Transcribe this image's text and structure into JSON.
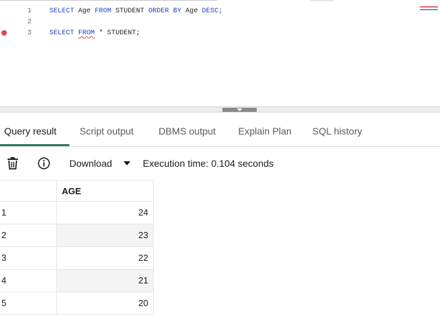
{
  "editor": {
    "lines": [
      {
        "number": "1",
        "tokens": [
          {
            "text": "SELECT",
            "kind": "kw"
          },
          {
            "text": " ",
            "kind": "id"
          },
          {
            "text": "Age",
            "kind": "id"
          },
          {
            "text": " ",
            "kind": "id"
          },
          {
            "text": "FROM",
            "kind": "kw"
          },
          {
            "text": " ",
            "kind": "id"
          },
          {
            "text": "STUDENT",
            "kind": "id"
          },
          {
            "text": " ",
            "kind": "id"
          },
          {
            "text": "ORDER",
            "kind": "kw"
          },
          {
            "text": " ",
            "kind": "id"
          },
          {
            "text": "BY",
            "kind": "kw"
          },
          {
            "text": " ",
            "kind": "id"
          },
          {
            "text": "Age",
            "kind": "id"
          },
          {
            "text": " ",
            "kind": "id"
          },
          {
            "text": "DESC;",
            "kind": "kw"
          }
        ]
      },
      {
        "number": "2",
        "tokens": []
      },
      {
        "number": "3",
        "breakpoint": true,
        "tokens": [
          {
            "text": "SELECT",
            "kind": "kw"
          },
          {
            "text": " ",
            "kind": "id"
          },
          {
            "text": "FROM",
            "kind": "kw",
            "error": true
          },
          {
            "text": " ",
            "kind": "id"
          },
          {
            "text": "*",
            "kind": "id"
          },
          {
            "text": " ",
            "kind": "id"
          },
          {
            "text": "STUDENT;",
            "kind": "id"
          }
        ]
      }
    ]
  },
  "tabs": [
    {
      "label": "Query result",
      "active": true
    },
    {
      "label": "Script output",
      "active": false
    },
    {
      "label": "DBMS output",
      "active": false
    },
    {
      "label": "Explain Plan",
      "active": false
    },
    {
      "label": "SQL history",
      "active": false
    }
  ],
  "toolbar": {
    "delete_icon": "trash-icon",
    "info_icon": "info-icon",
    "download_label": "Download",
    "execution_time": "Execution time: 0.104 seconds"
  },
  "results": {
    "columns": [
      "AGE"
    ],
    "rows": [
      {
        "row_number": "1",
        "age": "24"
      },
      {
        "row_number": "2",
        "age": "23"
      },
      {
        "row_number": "3",
        "age": "22"
      },
      {
        "row_number": "4",
        "age": "21"
      },
      {
        "row_number": "5",
        "age": "20"
      }
    ]
  },
  "colors": {
    "keyword": "#1f3fc7",
    "active_tab_underline": "#2e7d5b",
    "breakpoint": "#e0474c"
  }
}
